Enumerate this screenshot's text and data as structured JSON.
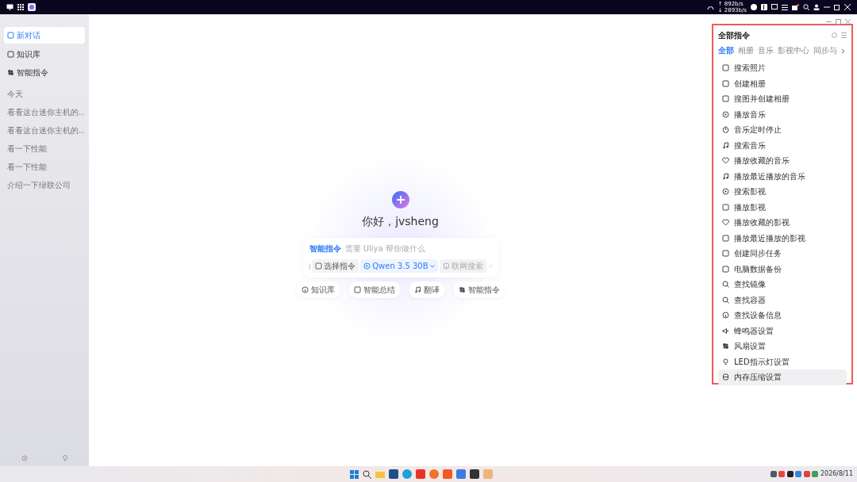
{
  "topbar": {
    "upload_speed": "↑ 892b/s",
    "download_speed": "↓ 2893b/s"
  },
  "sidebar": {
    "items": [
      {
        "label": "新对话",
        "selected": true
      },
      {
        "label": "知识库",
        "selected": false
      },
      {
        "label": "智能指令",
        "selected": false
      }
    ],
    "history_heading": "今天",
    "history": [
      "看看这台迷你主机的…",
      "看看这台迷你主机的…",
      "看一下性能",
      "看一下性能",
      "介绍一下绿联公司"
    ]
  },
  "greeting": "你好，jvsheng",
  "composer": {
    "tag": "智能指令",
    "placeholder": "需要 Uliya 帮你做什么",
    "select_command": "选择指令",
    "model": "Qwen 3.5 30B",
    "web_search": {
      "label": "联网搜索",
      "on": false
    }
  },
  "chips": [
    "知识库",
    "智能总结",
    "翻译",
    "智能指令"
  ],
  "panel": {
    "title": "全部指令",
    "highlighted": true,
    "tabs": [
      {
        "label": "全部",
        "selected": true
      },
      {
        "label": "相册",
        "selected": false
      },
      {
        "label": "音乐",
        "selected": false
      },
      {
        "label": "影视中心",
        "selected": false
      },
      {
        "label": "同步与",
        "selected": false
      }
    ],
    "items": [
      {
        "label": "搜索照片",
        "selected": false
      },
      {
        "label": "创建相册",
        "selected": false
      },
      {
        "label": "搜图并创建相册",
        "selected": false
      },
      {
        "label": "播放音乐",
        "selected": false
      },
      {
        "label": "音乐定时停止",
        "selected": false
      },
      {
        "label": "搜索音乐",
        "selected": false
      },
      {
        "label": "播放收藏的音乐",
        "selected": false
      },
      {
        "label": "播放最近播放的音乐",
        "selected": false
      },
      {
        "label": "搜索影视",
        "selected": false
      },
      {
        "label": "播放影视",
        "selected": false
      },
      {
        "label": "播放收藏的影视",
        "selected": false
      },
      {
        "label": "播放最近播放的影视",
        "selected": false
      },
      {
        "label": "创建同步任务",
        "selected": false
      },
      {
        "label": "电脑数据备份",
        "selected": false
      },
      {
        "label": "查找镜像",
        "selected": false
      },
      {
        "label": "查找容器",
        "selected": false
      },
      {
        "label": "查找设备信息",
        "selected": false
      },
      {
        "label": "蜂鸣器设置",
        "selected": false
      },
      {
        "label": "风扇设置",
        "selected": false
      },
      {
        "label": "LED指示灯设置",
        "selected": false
      },
      {
        "label": "内存压缩设置",
        "selected": true
      }
    ]
  },
  "taskbar": {
    "date": "2026/8/11"
  }
}
